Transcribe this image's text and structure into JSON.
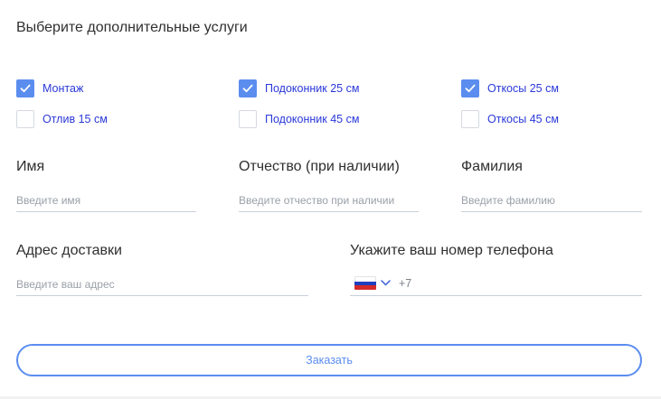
{
  "form": {
    "title": "Выберите дополнительные услуги",
    "accent_color": "#5b8def",
    "label_color": "#2b39d8",
    "options": [
      {
        "label": "Монтаж",
        "checked": true
      },
      {
        "label": "Подоконник 25 см",
        "checked": true
      },
      {
        "label": "Откосы 25 см",
        "checked": true
      },
      {
        "label": "Отлив 15 см",
        "checked": false
      },
      {
        "label": "Подоконник 45 см",
        "checked": false
      },
      {
        "label": "Откосы 45 см",
        "checked": false
      }
    ],
    "fields": {
      "first_name": {
        "label": "Имя",
        "placeholder": "Введите имя",
        "value": ""
      },
      "middle_name": {
        "label": "Отчество (при наличии)",
        "placeholder": "Введите отчество при наличии",
        "value": ""
      },
      "last_name": {
        "label": "Фамилия",
        "placeholder": "Введите фамилию",
        "value": ""
      },
      "address": {
        "label": "Адрес доставки",
        "placeholder": "Введите ваш адрес",
        "value": ""
      },
      "phone": {
        "label": "Укажите ваш номер телефона",
        "country_code": "+7",
        "country_icon": "russia-flag-icon",
        "value": ""
      }
    },
    "submit_label": "Заказать"
  }
}
